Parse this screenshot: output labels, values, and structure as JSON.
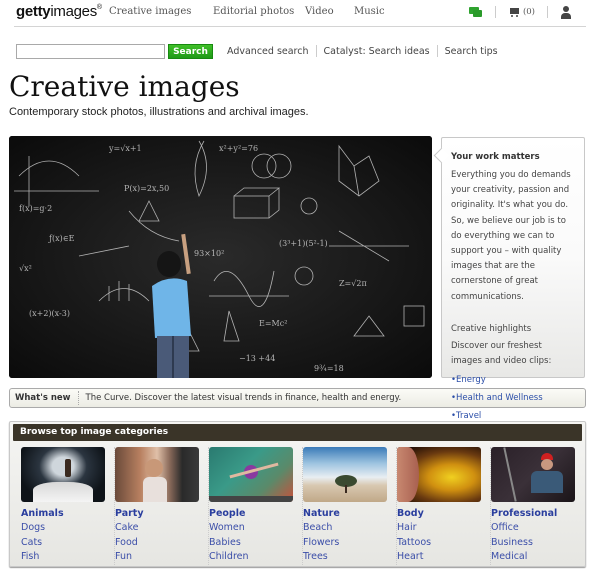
{
  "nav": {
    "logo_bold": "getty",
    "logo_light": "images",
    "logo_mark": "®",
    "links": [
      "Creative images",
      "Editorial photos",
      "Video",
      "Music"
    ],
    "icons": [
      "chat-icon",
      "cart-icon",
      "user-icon"
    ],
    "cart_count": "(0)"
  },
  "search": {
    "value": "",
    "placeholder": "",
    "button_label": "Search",
    "links": [
      "Advanced search",
      "Catalyst: Search ideas",
      "Search tips"
    ]
  },
  "page": {
    "title": "Creative images",
    "subtitle": "Contemporary stock photos, illustrations and archival images."
  },
  "hero": {
    "alt": "Boy in blue t-shirt writing on a chalkboard full of equations"
  },
  "side_panel": {
    "title": "Your work matters",
    "body": "Everything you do demands your creativity, passion and originality. It's what you do. So, we believe our job is to do everything we can to support you – with quality images that are the cornerstone of great communications.",
    "highlights_title": "Creative highlights",
    "highlights_body": "Discover our freshest images and video clips:",
    "links": [
      "•Energy",
      "•Health and Wellness",
      "•Travel"
    ]
  },
  "whats_new": {
    "label": "What's new",
    "text": "The Curve. Discover the latest visual trends in finance, health and energy."
  },
  "categories": {
    "heading": "Browse top image categories",
    "items": [
      {
        "title": "Animals",
        "links": [
          "Dogs",
          "Cats",
          "Fish"
        ]
      },
      {
        "title": "Party",
        "links": [
          "Cake",
          "Food",
          "Fun"
        ]
      },
      {
        "title": "People",
        "links": [
          "Women",
          "Babies",
          "Children"
        ]
      },
      {
        "title": "Nature",
        "links": [
          "Beach",
          "Flowers",
          "Trees"
        ]
      },
      {
        "title": "Body",
        "links": [
          "Hair",
          "Tattoos",
          "Heart"
        ]
      },
      {
        "title": "Professional",
        "links": [
          "Office",
          "Business",
          "Medical"
        ]
      }
    ]
  },
  "colors": {
    "accent_green": "#2aa520",
    "link_blue": "#2a3e9e",
    "category_header": "#3a3428"
  }
}
